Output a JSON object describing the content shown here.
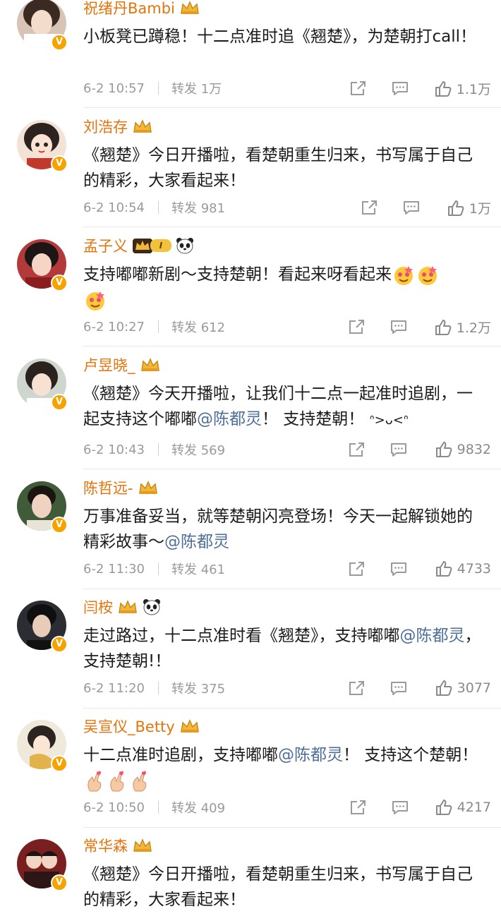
{
  "comments": [
    {
      "name": "祝绪丹Bambi",
      "text": "小板凳已蹲稳！十二点准时追《翘楚》，为楚朝打call！",
      "time": "6-2 10:57",
      "repost": "转发 1万",
      "likes": "1.1万",
      "avatar_color": "#d8c4b6"
    },
    {
      "name": "刘浩存",
      "text": "《翘楚》今日开播啦，看楚朝重生归来，书写属于自己的精彩，大家看起来！",
      "time": "6-2 10:54",
      "repost": "转发 981",
      "likes": "1万",
      "avatar_color": "#f3e3d6"
    },
    {
      "name": "孟子义",
      "text_parts": [
        "支持嘟嘟新剧～支持楚朝！看起来呀看起来"
      ],
      "time": "6-2 10:27",
      "repost": "转发 612",
      "likes": "1.2万",
      "level_badge": "I",
      "avatar_color": "#b23a3a"
    },
    {
      "name": "卢昱晓_",
      "text_parts": [
        "《翘楚》今天开播啦，让我们十二点一起准时追剧，一起支持这个嘟嘟",
        "@陈都灵",
        "！ 支持楚朝！",
        "ᐢ>ᴗ<ᐢ"
      ],
      "time": "6-2 10:43",
      "repost": "转发 569",
      "likes": "9832",
      "avatar_color": "#cfd6cf"
    },
    {
      "name": "陈哲远-",
      "text_parts": [
        "万事准备妥当，就等楚朝闪亮登场！今天一起解锁她的精彩故事～",
        "@陈都灵"
      ],
      "time": "6-2 11:30",
      "repost": "转发 461",
      "likes": "4733",
      "avatar_color": "#3f5b3a"
    },
    {
      "name": "闫桉",
      "text_parts": [
        "走过路过，十二点准时看《翘楚》，支持嘟嘟",
        "@陈都灵",
        "，支持楚朝!！"
      ],
      "time": "6-2 11:20",
      "repost": "转发 375",
      "likes": "3077",
      "avatar_color": "#2b2d33"
    },
    {
      "name": "吴宣仪_Betty",
      "text_parts": [
        "十二点准时追剧，支持嘟嘟",
        "@陈都灵",
        "！ 支持这个楚朝！"
      ],
      "time": "6-2 10:50",
      "repost": "转发 409",
      "likes": "4217",
      "avatar_color": "#efe9dc"
    },
    {
      "name": "常华森",
      "text": "《翘楚》今日开播啦，看楚朝重生归来，书写属于自己的精彩，大家看起来！",
      "avatar_color": "#7a1f1f"
    }
  ],
  "colors": {
    "name": "#e8730b",
    "mention": "#4f6f99",
    "meta": "#9a9a9a",
    "verified_badge": "#f6a300"
  },
  "icons": {
    "share": "share-icon",
    "comment": "comment-icon",
    "like": "thumbs-up-icon",
    "vip": "crown-icon",
    "verified": "verified-v-icon"
  }
}
